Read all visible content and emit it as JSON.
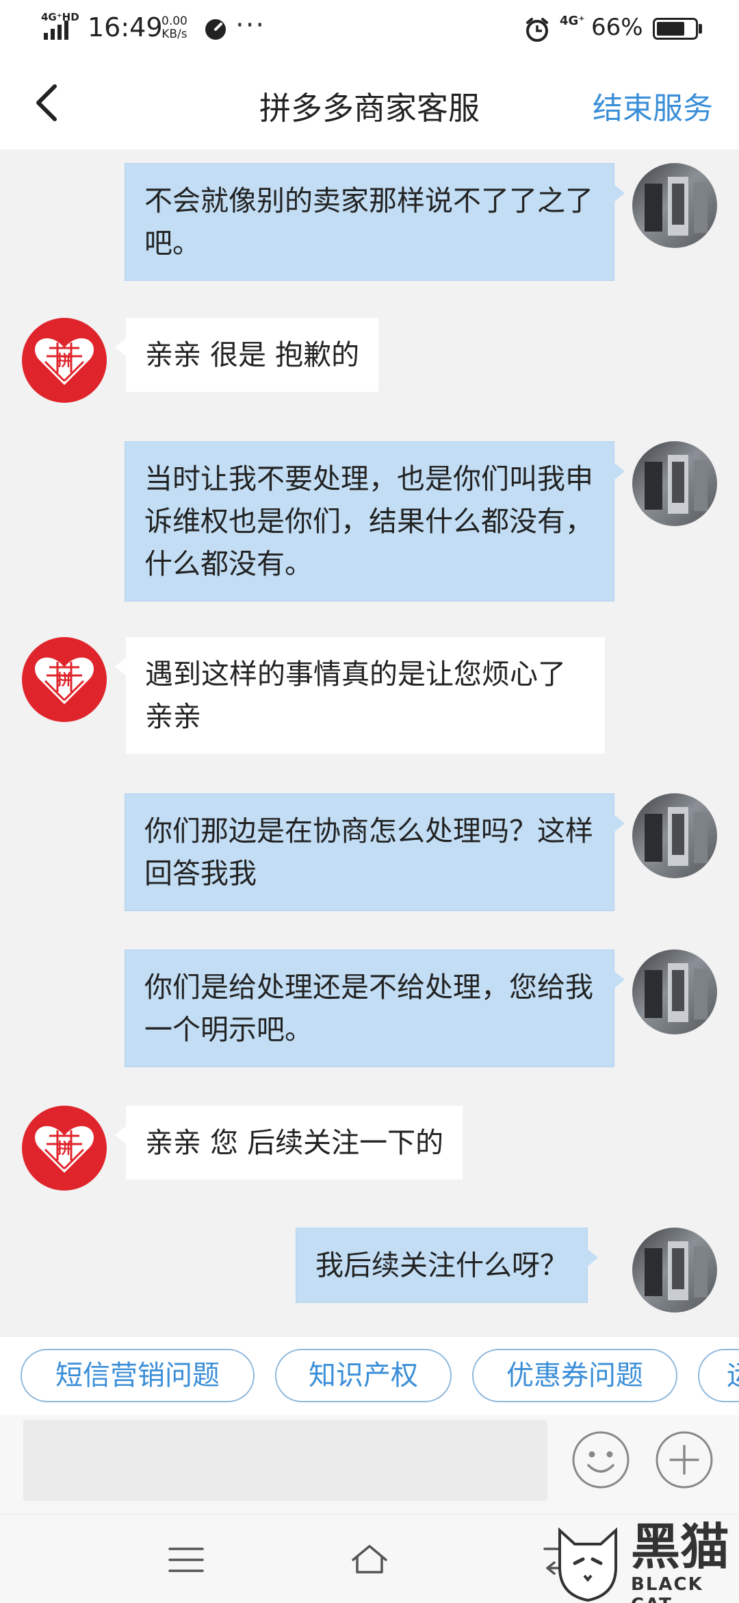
{
  "status_bar": {
    "network_label": "4G⁺HD",
    "time": "16:49",
    "speed_value": "0.00",
    "speed_unit": "KB/s",
    "overflow": "···",
    "network_right": "4G⁺",
    "battery_percent": "66%"
  },
  "header": {
    "title": "拼多多商家客服",
    "end_service": "结束服务"
  },
  "messages": [
    {
      "side": "out",
      "text": "不会就像别的卖家那样说不了了之了吧。"
    },
    {
      "side": "in",
      "text": "亲亲 很是 抱歉的"
    },
    {
      "side": "out",
      "text": "当时让我不要处理，也是你们叫我申诉维权也是你们，结果什么都没有，什么都没有。"
    },
    {
      "side": "in",
      "text": "遇到这样的事情真的是让您烦心了亲亲"
    },
    {
      "side": "out",
      "text": "你们那边是在协商怎么处理吗？这样回答我我"
    },
    {
      "side": "out",
      "text": "你们是给处理还是不给处理，您给我一个明示吧。"
    },
    {
      "side": "in",
      "text": "亲亲 您 后续关注一下的"
    },
    {
      "side": "out",
      "text": "我后续关注什么呀？"
    }
  ],
  "quick_replies": [
    "短信营销问题",
    "知识产权",
    "优惠券问题",
    "运"
  ],
  "input": {
    "value": ""
  },
  "watermark": {
    "main": "黑猫",
    "sub": "BLACK CAT"
  },
  "colors": {
    "accent": "#3a8ed8",
    "outgoing_bubble": "#c2ddf4",
    "brand_red": "#e0242b"
  }
}
